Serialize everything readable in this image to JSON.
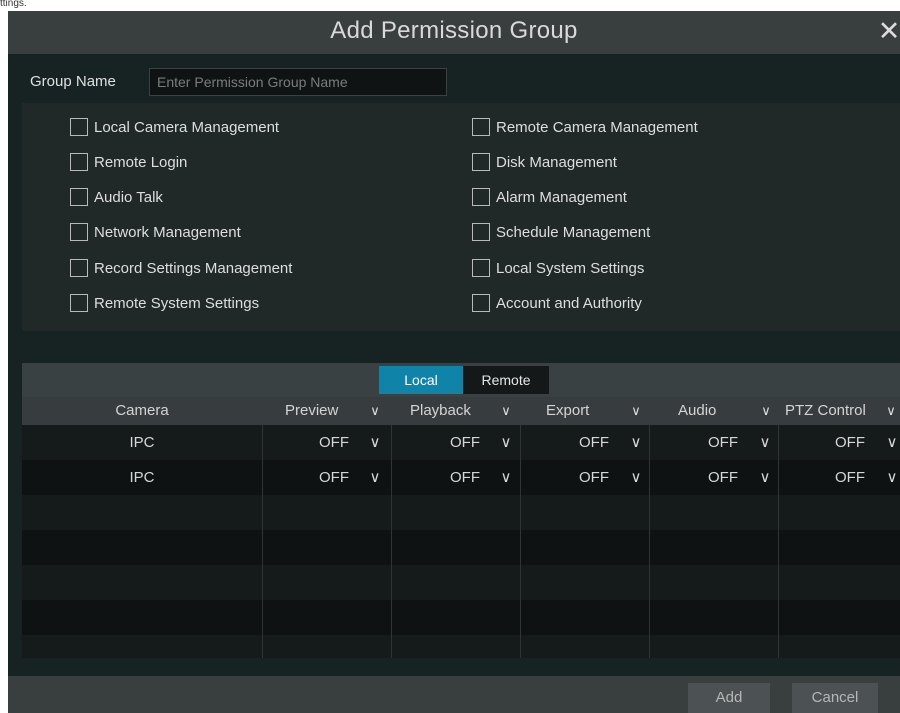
{
  "page_caption": "ttings.",
  "dialog": {
    "title": "Add Permission Group",
    "close_glyph": "✕"
  },
  "group_name": {
    "label": "Group Name",
    "placeholder": "Enter Permission Group Name",
    "value": ""
  },
  "permissions": {
    "left": [
      {
        "label": "Local Camera Management",
        "checked": false
      },
      {
        "label": "Remote Login",
        "checked": false
      },
      {
        "label": "Audio Talk",
        "checked": false
      },
      {
        "label": "Network Management",
        "checked": false
      },
      {
        "label": "Record Settings Management",
        "checked": false
      },
      {
        "label": "Remote System Settings",
        "checked": false
      }
    ],
    "right": [
      {
        "label": "Remote Camera Management",
        "checked": false
      },
      {
        "label": "Disk Management",
        "checked": false
      },
      {
        "label": "Alarm Management",
        "checked": false
      },
      {
        "label": "Schedule Management",
        "checked": false
      },
      {
        "label": "Local System Settings",
        "checked": false
      },
      {
        "label": "Account and Authority",
        "checked": false
      }
    ]
  },
  "tabs": {
    "local": "Local",
    "remote": "Remote",
    "active": "Local"
  },
  "table": {
    "columns": [
      "Camera",
      "Preview",
      "Playback",
      "Export",
      "Audio",
      "PTZ Control"
    ],
    "rows": [
      {
        "camera": "IPC",
        "preview": "OFF",
        "playback": "OFF",
        "export": "OFF",
        "audio": "OFF",
        "ptz": "OFF"
      },
      {
        "camera": "IPC",
        "preview": "OFF",
        "playback": "OFF",
        "export": "OFF",
        "audio": "OFF",
        "ptz": "OFF"
      }
    ],
    "chevron_glyph": "∨"
  },
  "buttons": {
    "add": "Add",
    "cancel": "Cancel"
  },
  "colors": {
    "accent": "#0f84a8",
    "background": "#172222",
    "titlebar": "#393e3f"
  }
}
